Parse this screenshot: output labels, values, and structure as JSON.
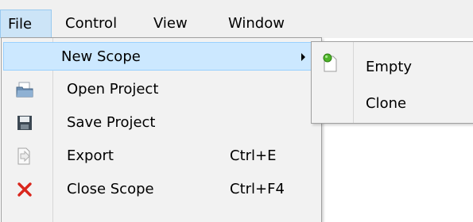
{
  "menubar": {
    "items": [
      {
        "label": "File",
        "open": true
      },
      {
        "label": "Control"
      },
      {
        "label": "View"
      },
      {
        "label": "Window"
      }
    ]
  },
  "file_menu": {
    "items": [
      {
        "label": "New Scope",
        "shortcut": "",
        "icon": "none",
        "has_submenu": true,
        "highlighted": true
      },
      {
        "label": "Open Project",
        "shortcut": "",
        "icon": "folder-open-icon"
      },
      {
        "label": "Save Project",
        "shortcut": "",
        "icon": "floppy-disk-icon"
      },
      {
        "label": "Export",
        "shortcut": "Ctrl+E",
        "icon": "export-document-icon"
      },
      {
        "label": "Close Scope",
        "shortcut": "Ctrl+F4",
        "icon": "red-x-icon"
      }
    ]
  },
  "new_scope_submenu": {
    "items": [
      {
        "label": "Empty",
        "icon": "new-document-icon"
      },
      {
        "label": "Clone",
        "icon": "none"
      }
    ]
  },
  "colors": {
    "menubar_bg": "#f0f0f0",
    "menu_bg": "#f2f2f2",
    "highlight_bg": "#cce8ff",
    "highlight_border": "#99d1ff",
    "close_icon": "#d9261c"
  }
}
